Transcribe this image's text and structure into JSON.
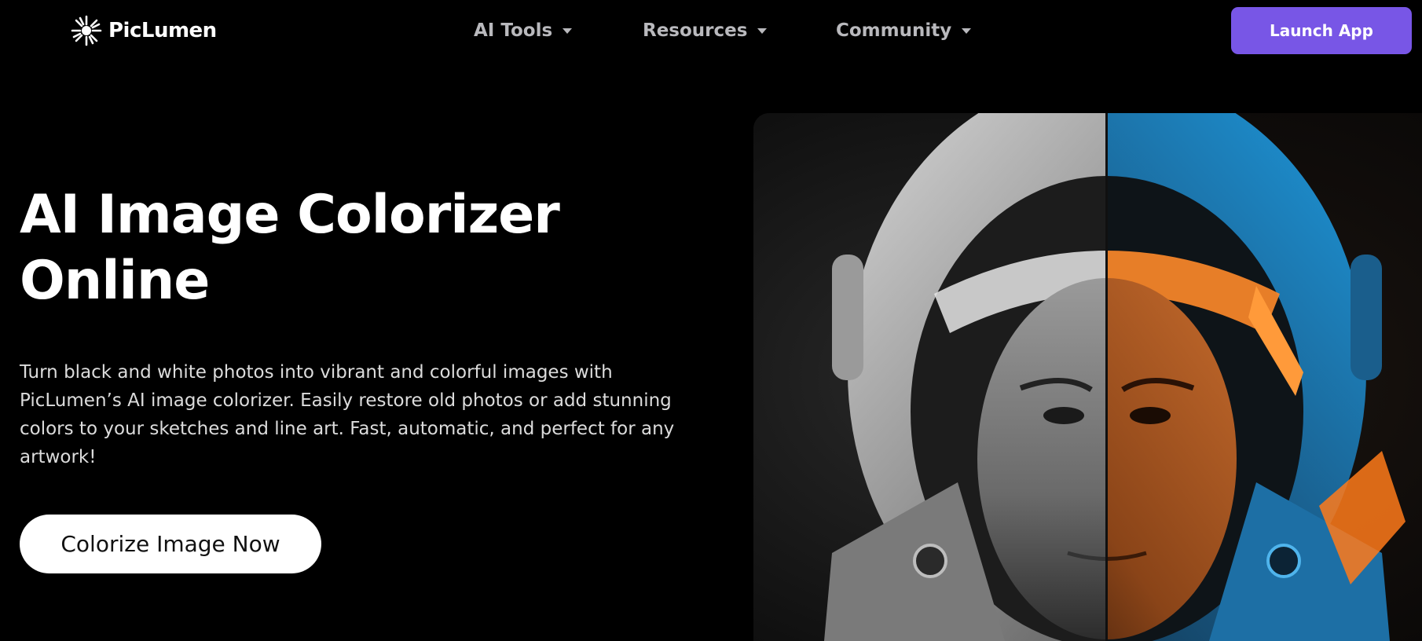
{
  "brand": {
    "name": "PicLumen",
    "logo_icon": "sunburst-icon"
  },
  "nav": {
    "items": [
      {
        "label": "AI Tools",
        "icon": "chevron-down-icon"
      },
      {
        "label": "Resources",
        "icon": "chevron-down-icon"
      },
      {
        "label": "Community",
        "icon": "chevron-down-icon"
      }
    ],
    "launch_label": "Launch App"
  },
  "hero": {
    "title_line1": "AI Image Colorizer",
    "title_line2": "Online",
    "description_lines": [
      "Turn black and white photos into vibrant and colorful images with",
      "PicLumen’s AI image colorizer. Easily restore old photos or add stunning",
      "colors to your sketches and line art. Fast, automatic, and perfect for any",
      "artwork!"
    ],
    "cta_label": "Colorize Image Now"
  },
  "colors": {
    "background": "#000000",
    "accent": "#7856e6",
    "nav_text": "#b9b9bd",
    "cta_background": "#ffffff",
    "image_warm": "#ff8a2a",
    "image_cool": "#1e9be0"
  }
}
